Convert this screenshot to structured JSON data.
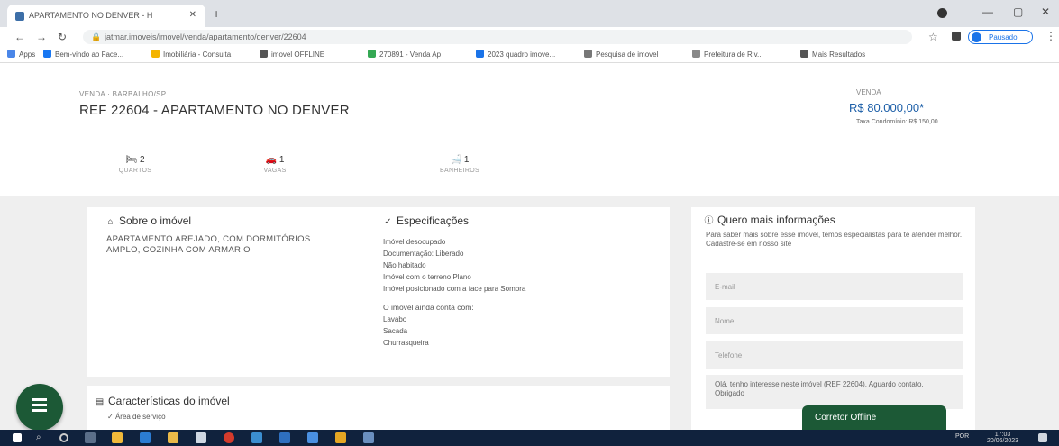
{
  "browser": {
    "tab_title": "APARTAMENTO NO DENVER - H",
    "url": "jatmar.imoveis/imovel/venda/apartamento/denver/22604",
    "profile_label": "Pausado",
    "bookmarks": [
      {
        "label": "Apps",
        "color": "#4a86e8"
      },
      {
        "label": "Bem-vindo ao Face...",
        "color": "#1877f2"
      },
      {
        "label": "Imobiliária - Consulta",
        "color": "#f4b400"
      },
      {
        "label": "imovel OFFLINE",
        "color": "#555555"
      },
      {
        "label": "270891 - Venda Ap",
        "color": "#34a853"
      },
      {
        "label": "2023 quadro imove...",
        "color": "#1a73e8"
      },
      {
        "label": "Pesquisa de imovel",
        "color": "#777777"
      },
      {
        "label": "Prefeitura de Riv...",
        "color": "#888888"
      },
      {
        "label": "Mais Resultados",
        "color": "#555555"
      }
    ]
  },
  "property": {
    "breadcrumb": "VENDA · BARBALHO/SP",
    "title": "REF 22604 - APARTAMENTO NO DENVER",
    "price_label": "VENDA",
    "price": "R$ 80.000,00*",
    "condo": "Taxa Condomínio: R$ 150,00",
    "features": [
      {
        "value": "2",
        "label": "QUARTOS",
        "icon": "bed-icon"
      },
      {
        "value": "1",
        "label": "VAGAS",
        "icon": "car-icon"
      },
      {
        "value": "1",
        "label": "BANHEIROS",
        "icon": "bath-icon"
      }
    ]
  },
  "about": {
    "title": "Sobre o imóvel",
    "icon": "home-icon",
    "text": "APARTAMENTO AREJADO, COM DORMITÓRIOS AMPLO, COZINHA COM ARMARIO"
  },
  "specs": {
    "title": "Especificações",
    "icon": "check-icon",
    "lines": [
      "Imóvel desocupado",
      "Documentação: Liberado",
      "Não habitado",
      "Imóvel com o terreno Plano",
      "Imóvel posicionado com a face para Sombra"
    ],
    "extras_title": "O imóvel ainda conta com:",
    "extras": [
      "Lavabo",
      "Sacada",
      "Churrasqueira"
    ]
  },
  "contact": {
    "title": "Quero mais informações",
    "icon": "info-icon",
    "subtitle": "Para saber mais sobre esse imóvel, temos especialistas para te atender melhor. Cadastre-se em nosso site",
    "email_placeholder": "E-mail",
    "name_placeholder": "Nome",
    "phone_placeholder": "Telefone",
    "message": "Olá, tenho interesse neste imóvel (REF 22604). Aguardo contato. Obrigado"
  },
  "characteristics": {
    "title": "Características do imóvel",
    "icon": "list-icon",
    "first_item": "Área de serviço"
  },
  "chat": {
    "label": "Corretor Offline"
  },
  "taskbar": {
    "time": "17:03",
    "date": "20/06/2023",
    "lang": "POR"
  }
}
